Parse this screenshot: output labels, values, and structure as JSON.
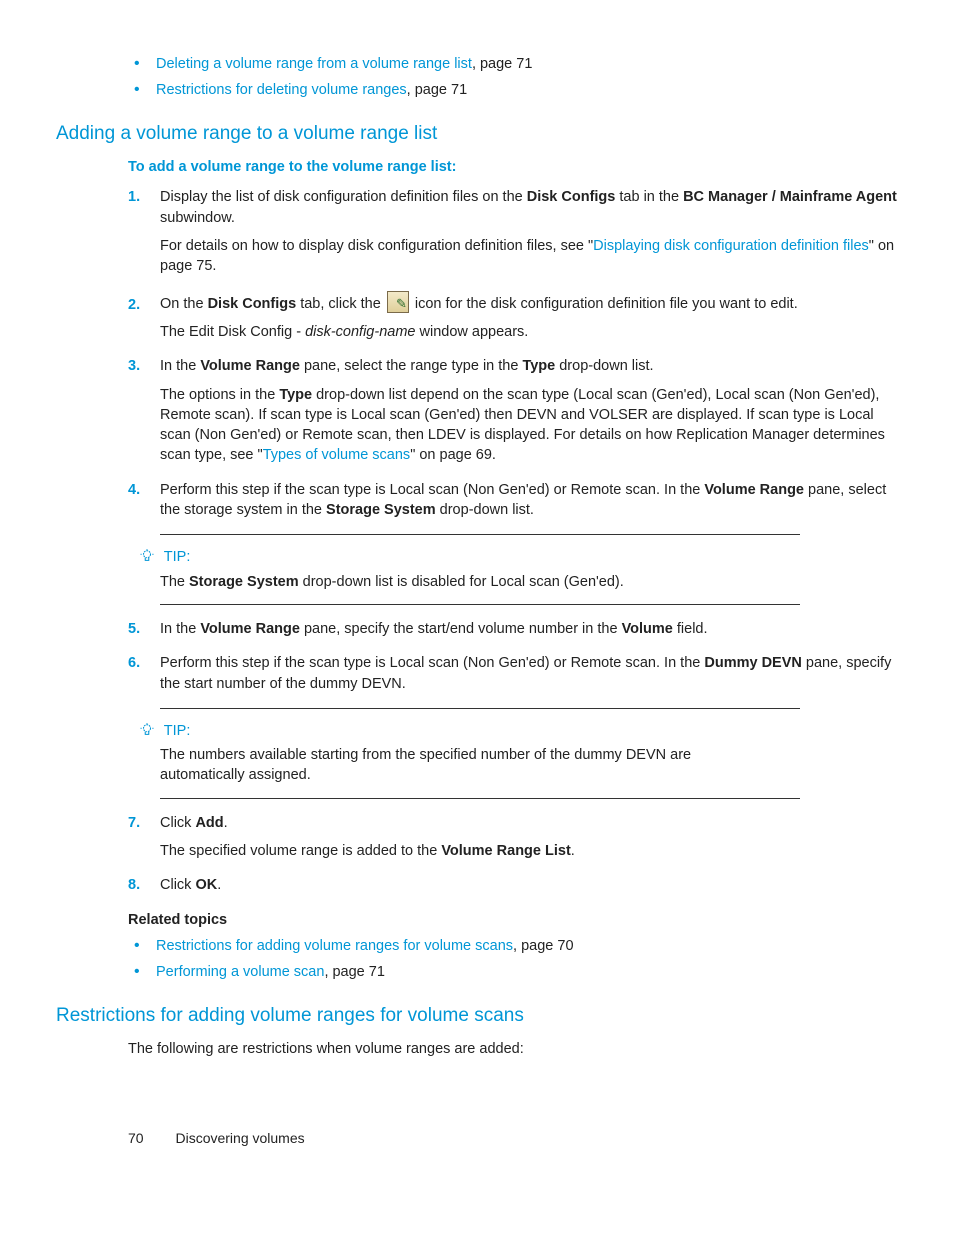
{
  "topLinks": [
    {
      "link": "Deleting a volume range from a volume range list",
      "suffix": ", page 71"
    },
    {
      "link": "Restrictions for deleting volume ranges",
      "suffix": ", page 71"
    }
  ],
  "section1": {
    "title": "Adding a volume range to a volume range list",
    "intro": "To add a volume range to the volume range list:",
    "steps": {
      "s1": {
        "num": "1.",
        "t1a": "Display the list of disk configuration definition files on the ",
        "t1b": "Disk Configs",
        "t1c": " tab in the ",
        "t1d": "BC Manager / Mainframe Agent",
        "t1e": " subwindow.",
        "t2a": "For details on how to display disk configuration definition files, see \"",
        "t2link": "Displaying disk configuration definition files",
        "t2b": "\" on page 75."
      },
      "s2": {
        "num": "2.",
        "t1a": "On the ",
        "t1b": "Disk Configs",
        "t1c": " tab, click the ",
        "t1d": " icon for the disk configuration definition file you want to edit.",
        "t2a": "The Edit Disk Config - ",
        "t2i": "disk-config-name",
        "t2b": " window appears."
      },
      "s3": {
        "num": "3.",
        "t1a": "In the ",
        "t1b": "Volume Range",
        "t1c": " pane, select the range type in the ",
        "t1d": "Type",
        "t1e": " drop-down list.",
        "t2a": "The options in the ",
        "t2b": "Type",
        "t2c": " drop-down list depend on the scan type (Local scan (Gen'ed), Local scan (Non Gen'ed), Remote scan). If scan type is Local scan (Gen'ed) then DEVN and VOLSER are displayed. If scan type is Local scan (Non Gen'ed) or Remote scan, then LDEV is displayed. For details on how Replication Manager determines scan type, see \"",
        "t2link": "Types of volume scans",
        "t2d": "\" on page 69."
      },
      "s4": {
        "num": "4.",
        "t1a": "Perform this step if the scan type is Local scan (Non Gen'ed) or Remote scan. In the ",
        "t1b": "Volume Range",
        "t1c": " pane, select the storage system in the ",
        "t1d": "Storage System",
        "t1e": " drop-down list."
      },
      "s5": {
        "num": "5.",
        "t1a": "In the ",
        "t1b": "Volume Range",
        "t1c": " pane, specify the start/end volume number in the ",
        "t1d": "Volume",
        "t1e": " field."
      },
      "s6": {
        "num": "6.",
        "t1a": "Perform this step if the scan type is Local scan (Non Gen'ed) or Remote scan. In the ",
        "t1b": "Dummy DEVN",
        "t1c": " pane, specify the start number of the dummy DEVN."
      },
      "s7": {
        "num": "7.",
        "t1a": "Click ",
        "t1b": "Add",
        "t1c": ".",
        "t2a": "The specified volume range is added to the ",
        "t2b": "Volume Range List",
        "t2c": "."
      },
      "s8": {
        "num": "8.",
        "t1a": "Click ",
        "t1b": "OK",
        "t1c": "."
      }
    },
    "tip1": {
      "head": "TIP:",
      "b1": "The ",
      "b2": "Storage System",
      "b3": " drop-down list is disabled for Local scan (Gen'ed)."
    },
    "tip2": {
      "head": "TIP:",
      "body": "The numbers available starting from the specified number of the dummy DEVN are automatically assigned."
    },
    "relatedHead": "Related topics",
    "related": [
      {
        "link": "Restrictions for adding volume ranges for volume scans",
        "suffix": ", page 70"
      },
      {
        "link": "Performing a volume scan",
        "suffix": ", page 71"
      }
    ]
  },
  "section2": {
    "title": "Restrictions for adding volume ranges for volume scans",
    "body": "The following are restrictions when volume ranges are added:"
  },
  "footer": {
    "page": "70",
    "chapter": "Discovering volumes"
  }
}
